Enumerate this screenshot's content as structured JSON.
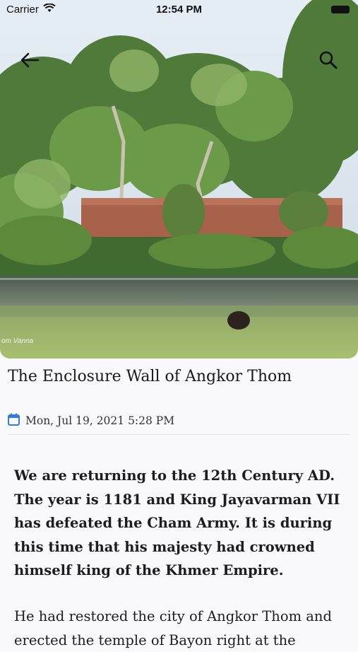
{
  "status_bar": {
    "carrier": "Carrier",
    "time": "12:54 PM"
  },
  "hero": {
    "photo_credit": "om Vanna"
  },
  "article": {
    "title": "The Enclosure Wall of Angkor Thom",
    "date": "Mon, Jul 19, 2021 5:28 PM",
    "paragraphs": [
      "We are returning to the 12th Century AD. The year is 1181 and King Jayavarman VII has defeated the Cham Army. It is during this time that his majesty had crowned himself king of the Khmer Empire.",
      "He had restored the city of Angkor Thom and erected the temple of Bayon right at the"
    ]
  },
  "icons": {
    "back": "arrow-left-icon",
    "search": "search-icon",
    "calendar": "calendar-icon",
    "wifi": "wifi-icon"
  },
  "colors": {
    "accent": "#2f7fd8"
  }
}
